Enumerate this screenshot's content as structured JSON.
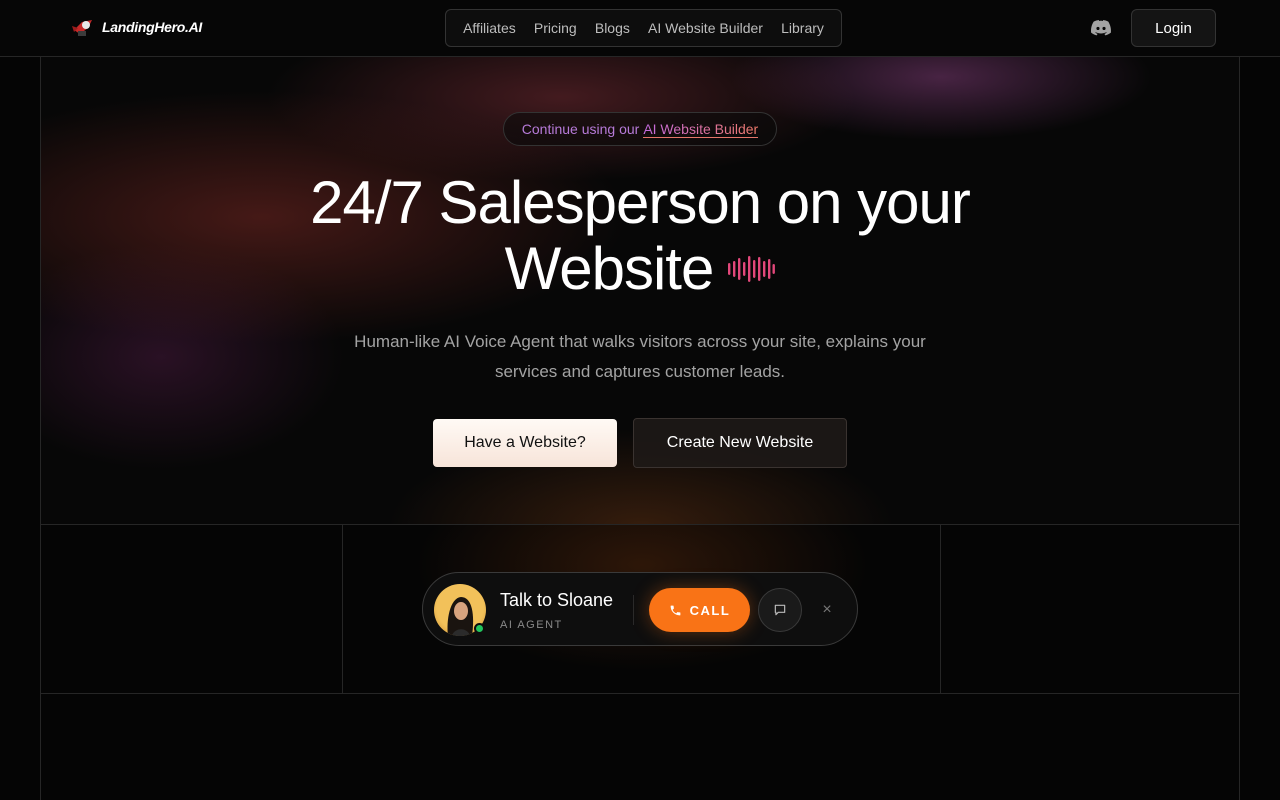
{
  "brand": {
    "name": "LandingHero.AI"
  },
  "nav": {
    "links": [
      "Affiliates",
      "Pricing",
      "Blogs",
      "AI Website Builder",
      "Library"
    ],
    "login_label": "Login"
  },
  "hero": {
    "pill_prefix": "Continue using our",
    "pill_link": "AI Website Builder",
    "title_line1": "24/7 Salesperson on your",
    "title_line2": "Website",
    "subtitle": "Human-like AI Voice Agent that walks visitors across your site, explains your services and captures customer leads.",
    "primary_cta": "Have a Website?",
    "secondary_cta": "Create New Website"
  },
  "widget": {
    "agent_name": "Talk to Sloane",
    "agent_role": "AI AGENT",
    "call_label": "CALL",
    "close_glyph": "×",
    "status_color": "#22c55e",
    "accent": "#f97316"
  }
}
